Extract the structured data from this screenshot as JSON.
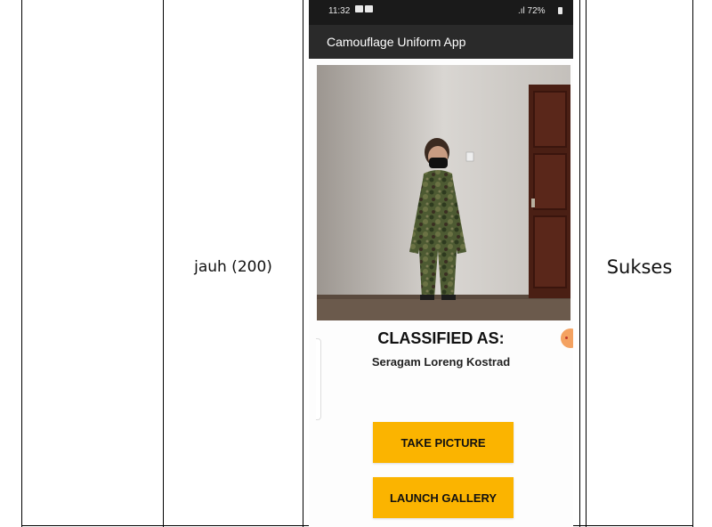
{
  "table": {
    "row_label": "jauh (200)",
    "result": "Sukses"
  },
  "phone": {
    "status_bar": {
      "time": "11:32",
      "signal_battery": ".ıl 72%"
    },
    "app_title": "Camouflage Uniform App",
    "photo_icon": "person-in-camouflage-uniform-photo",
    "classified_label": "CLASSIFIED AS:",
    "classified_value": "Seragam Loreng Kostrad",
    "buttons": {
      "take_picture": "TAKE PICTURE",
      "launch_gallery": "LAUNCH GALLERY"
    },
    "colors": {
      "button": "#fbb400",
      "appbar": "#2a2a2a"
    }
  }
}
